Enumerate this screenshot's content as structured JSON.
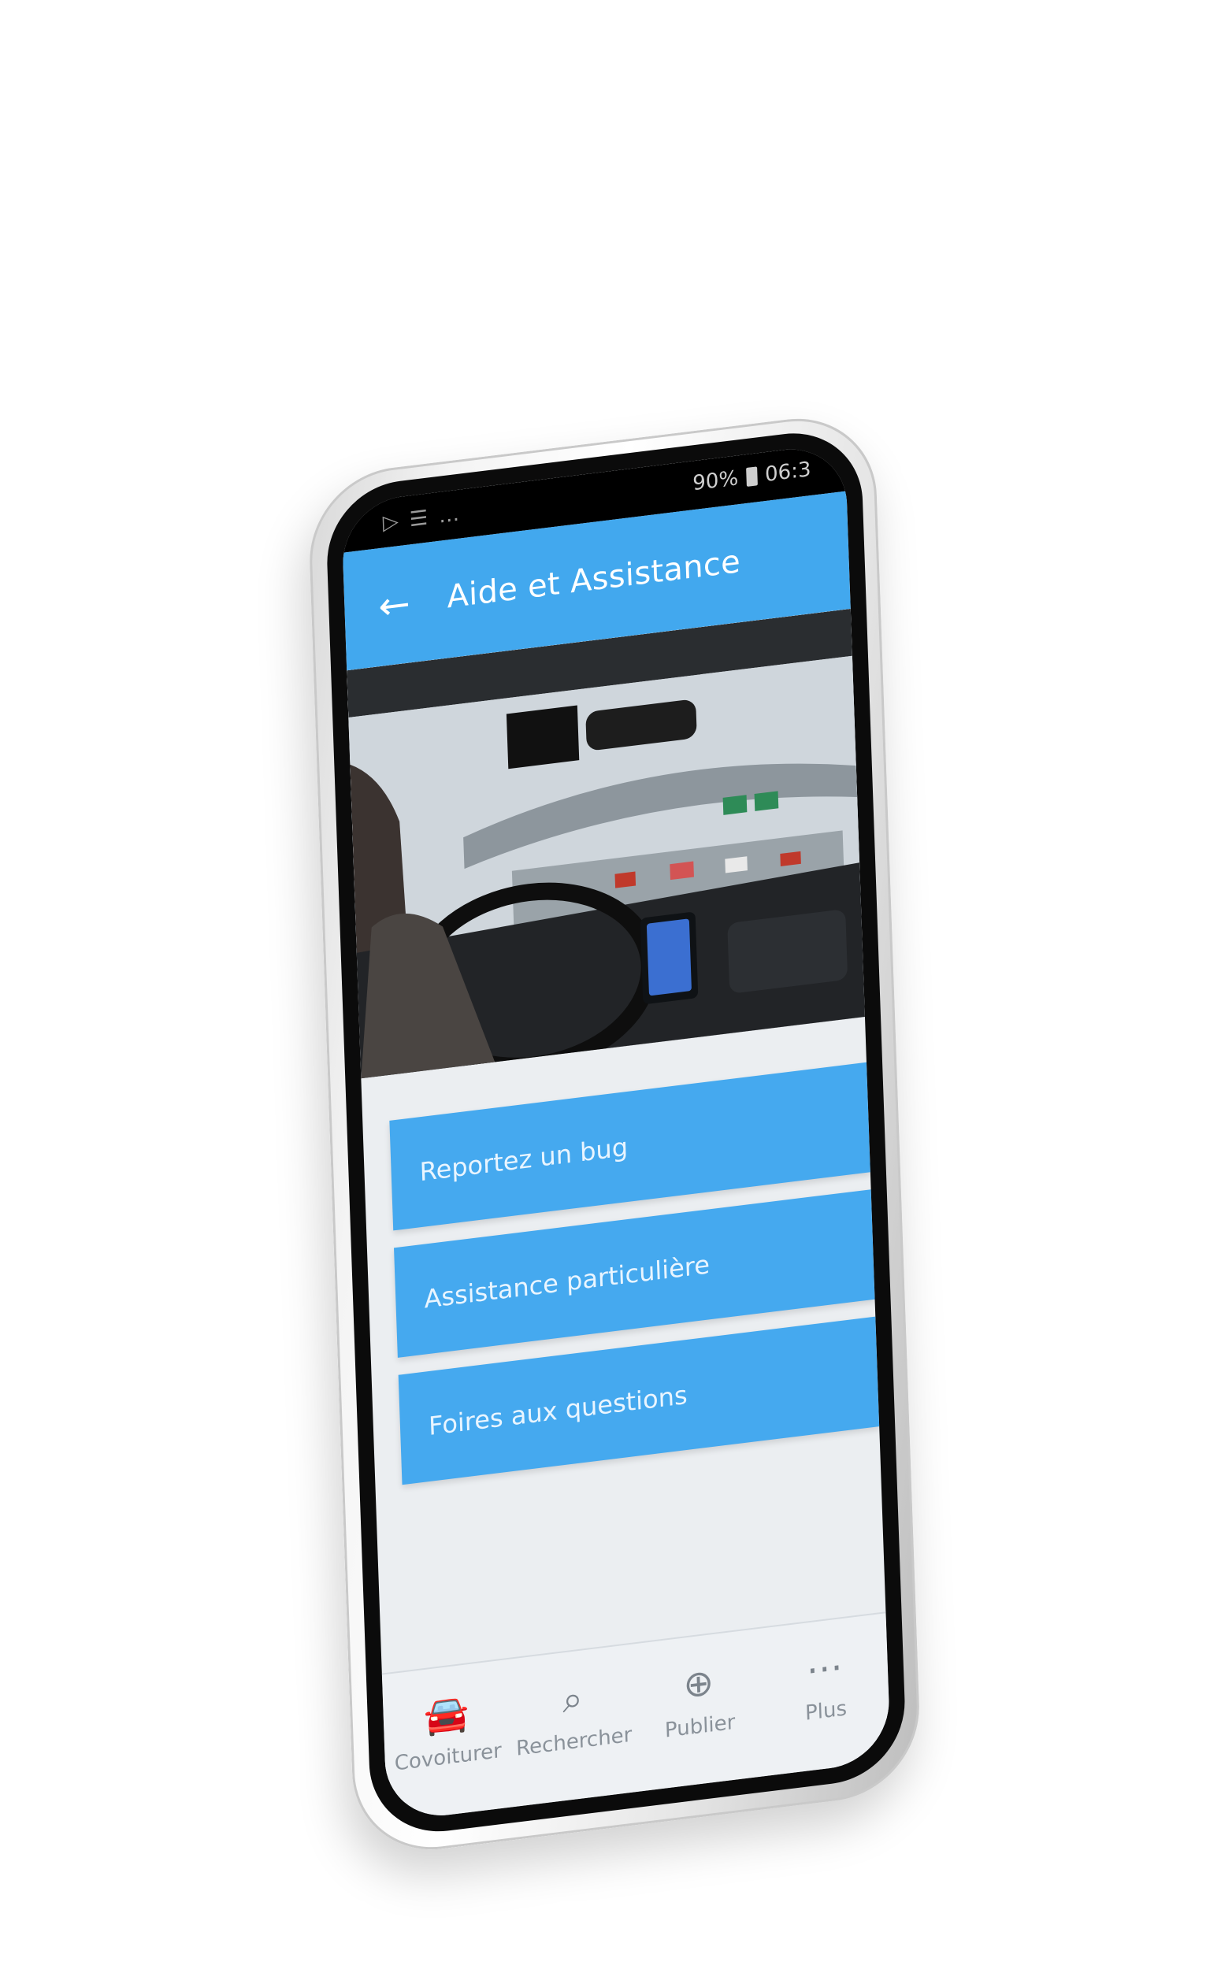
{
  "status_bar": {
    "battery": "90%",
    "time": "06:3"
  },
  "app_bar": {
    "back_icon": "arrow-left-icon",
    "title": "Aide et Assistance"
  },
  "hero": {
    "image": "car-dashboard-traffic-photo"
  },
  "menu": {
    "items": [
      {
        "label": "Reportez un bug"
      },
      {
        "label": "Assistance particulière"
      },
      {
        "label": "Foires aux questions"
      }
    ]
  },
  "bottom_nav": {
    "items": [
      {
        "label": "Covoiturer",
        "icon": "car-icon"
      },
      {
        "label": "Rechercher",
        "icon": "search-icon"
      },
      {
        "label": "Publier",
        "icon": "plus-circle-icon"
      },
      {
        "label": "Plus",
        "icon": "more-icon"
      }
    ]
  },
  "colors": {
    "accent": "#42a8ee",
    "screen_bg": "#ebeef1"
  }
}
